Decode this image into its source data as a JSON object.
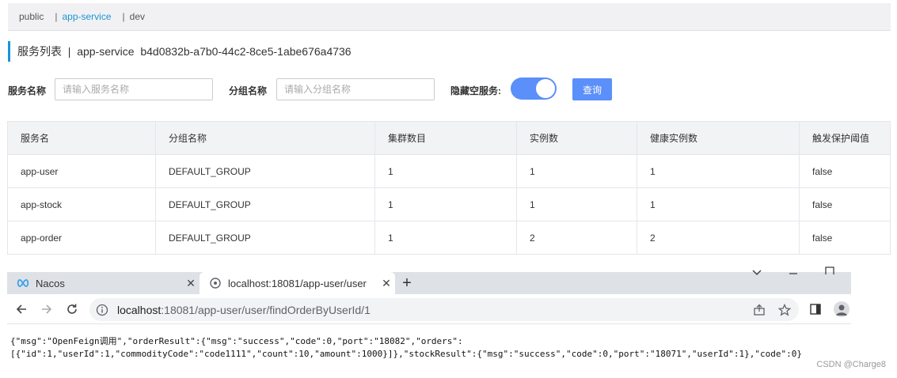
{
  "namespaces": [
    {
      "label": "public",
      "active": false
    },
    {
      "label": "app-service",
      "active": true
    },
    {
      "label": "dev",
      "active": false
    }
  ],
  "namespace_separator": "|",
  "page": {
    "title": "服务列表",
    "title_separator": "|",
    "namespace_name": "app-service",
    "namespace_id": "b4d0832b-a7b0-44c2-8ce5-1abe676a4736"
  },
  "filters": {
    "service_name_label": "服务名称",
    "service_name_placeholder": "请输入服务名称",
    "group_name_label": "分组名称",
    "group_name_placeholder": "请输入分组名称",
    "hide_empty_label": "隐藏空服务:",
    "hide_empty_enabled": true,
    "query_button": "查询"
  },
  "table": {
    "headers": [
      "服务名",
      "分组名称",
      "集群数目",
      "实例数",
      "健康实例数",
      "触发保护阈值"
    ],
    "rows": [
      [
        "app-user",
        "DEFAULT_GROUP",
        "1",
        "1",
        "1",
        "false"
      ],
      [
        "app-stock",
        "DEFAULT_GROUP",
        "1",
        "1",
        "1",
        "false"
      ],
      [
        "app-order",
        "DEFAULT_GROUP",
        "1",
        "2",
        "2",
        "false"
      ]
    ]
  },
  "browser": {
    "tabs": [
      {
        "title": "Nacos",
        "icon": "nacos-logo-icon",
        "active": false
      },
      {
        "title": "localhost:18081/app-user/user",
        "icon": "globe-icon",
        "active": true
      }
    ],
    "new_tab": "+",
    "window_controls": [
      "chevron-down-icon",
      "minimize-icon",
      "maximize-icon"
    ],
    "url_host": "localhost",
    "url_path": ":18081/app-user/user/findOrderByUserId/1"
  },
  "response": {
    "line1": "{\"msg\":\"OpenFeign调用\",\"orderResult\":{\"msg\":\"success\",\"code\":0,\"port\":\"18082\",\"orders\":",
    "line2": "[{\"id\":1,\"userId\":1,\"commodityCode\":\"code1111\",\"count\":10,\"amount\":1000}]},\"stockResult\":{\"msg\":\"success\",\"code\":0,\"port\":\"18071\",\"userId\":1},\"code\":0}"
  },
  "watermark": "CSDN @Charge8",
  "colors": {
    "accent": "#1a95d6",
    "primary_button": "#5b8ff9",
    "table_header": "#f2f3f5",
    "tabstrip": "#dee1e6"
  }
}
